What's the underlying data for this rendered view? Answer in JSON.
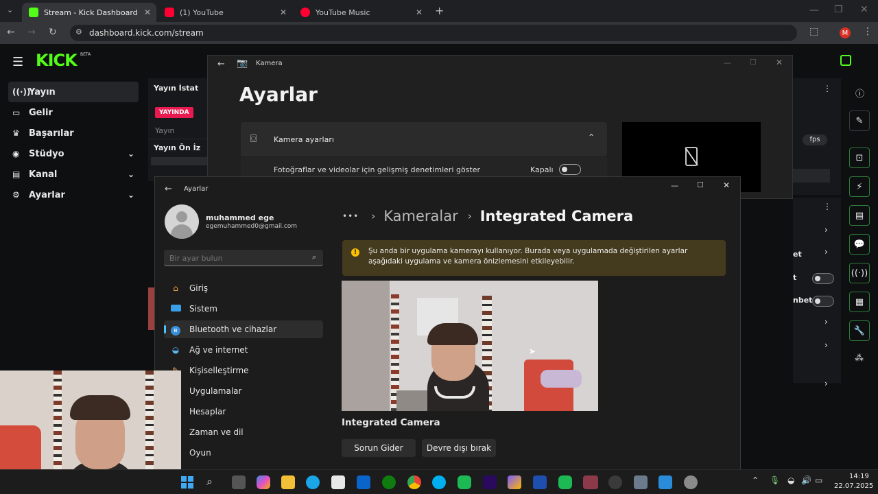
{
  "browser": {
    "tabs": [
      {
        "label": "Stream - Kick Dashboard",
        "color": "#53fc18"
      },
      {
        "label": "(1) YouTube",
        "color": "#ff0033"
      },
      {
        "label": "YouTube Music",
        "color": "#ff0033"
      }
    ],
    "url": "dashboard.kick.com/stream",
    "profile_initial": "M"
  },
  "kick": {
    "logo": "KICK",
    "logo_badge": "BETA",
    "nav": [
      {
        "label": "Yayın",
        "icon": "broadcast-icon"
      },
      {
        "label": "Gelir",
        "icon": "money-icon"
      },
      {
        "label": "Başarılar",
        "icon": "trophy-icon"
      },
      {
        "label": "Stüdyo",
        "icon": "studio-icon"
      },
      {
        "label": "Kanal",
        "icon": "channel-icon"
      },
      {
        "label": "Ayarlar",
        "icon": "gear-icon"
      }
    ],
    "panel1_title": "Yayın İstat",
    "live_badge": "YAYINDA",
    "panel1_sub": "Yayın",
    "panel2_title": "Yayın Ön İz",
    "right_partial": {
      "fps": "fps",
      "row_a": "et",
      "row_b": "t",
      "row_c": "nbet"
    },
    "accent": "#53fc18"
  },
  "kamera": {
    "title": "Kamera",
    "heading": "Ayarlar",
    "section": "Kamera ayarları",
    "option_label": "Fotoğraflar ve videolar için gelişmiş denetimleri göster",
    "option_state": "Kapalı"
  },
  "settings": {
    "title": "Ayarlar",
    "user_name": "muhammed ege",
    "user_email": "egemuhammed0@gmail.com",
    "search_placeholder": "Bir ayar bulun",
    "nav": [
      {
        "label": "Giriş",
        "icon": "home-icon"
      },
      {
        "label": "Sistem",
        "icon": "system-icon"
      },
      {
        "label": "Bluetooth ve cihazlar",
        "icon": "bluetooth-icon"
      },
      {
        "label": "Ağ ve internet",
        "icon": "wifi-icon"
      },
      {
        "label": "Kişiselleştirme",
        "icon": "brush-icon"
      },
      {
        "label": "Uygulamalar",
        "icon": "apps-icon"
      },
      {
        "label": "Hesaplar",
        "icon": "account-icon"
      },
      {
        "label": "Zaman ve dil",
        "icon": "clock-icon"
      },
      {
        "label": "Oyun",
        "icon": "game-icon"
      }
    ],
    "breadcrumb": {
      "ellipsis": "•••",
      "parent": "Kameralar",
      "current": "Integrated Camera"
    },
    "warning": "Şu anda bir uygulama kamerayı kullanıyor. Burada veya uygulamada değiştirilen ayarlar aşağıdaki uygulama ve kamera önizlemesini etkileyebilir.",
    "camera_name": "Integrated Camera",
    "buttons": {
      "troubleshoot": "Sorun Gider",
      "disable": "Devre dışı bırak"
    }
  },
  "taskbar": {
    "time": "14:19",
    "date": "22.07.2025"
  }
}
